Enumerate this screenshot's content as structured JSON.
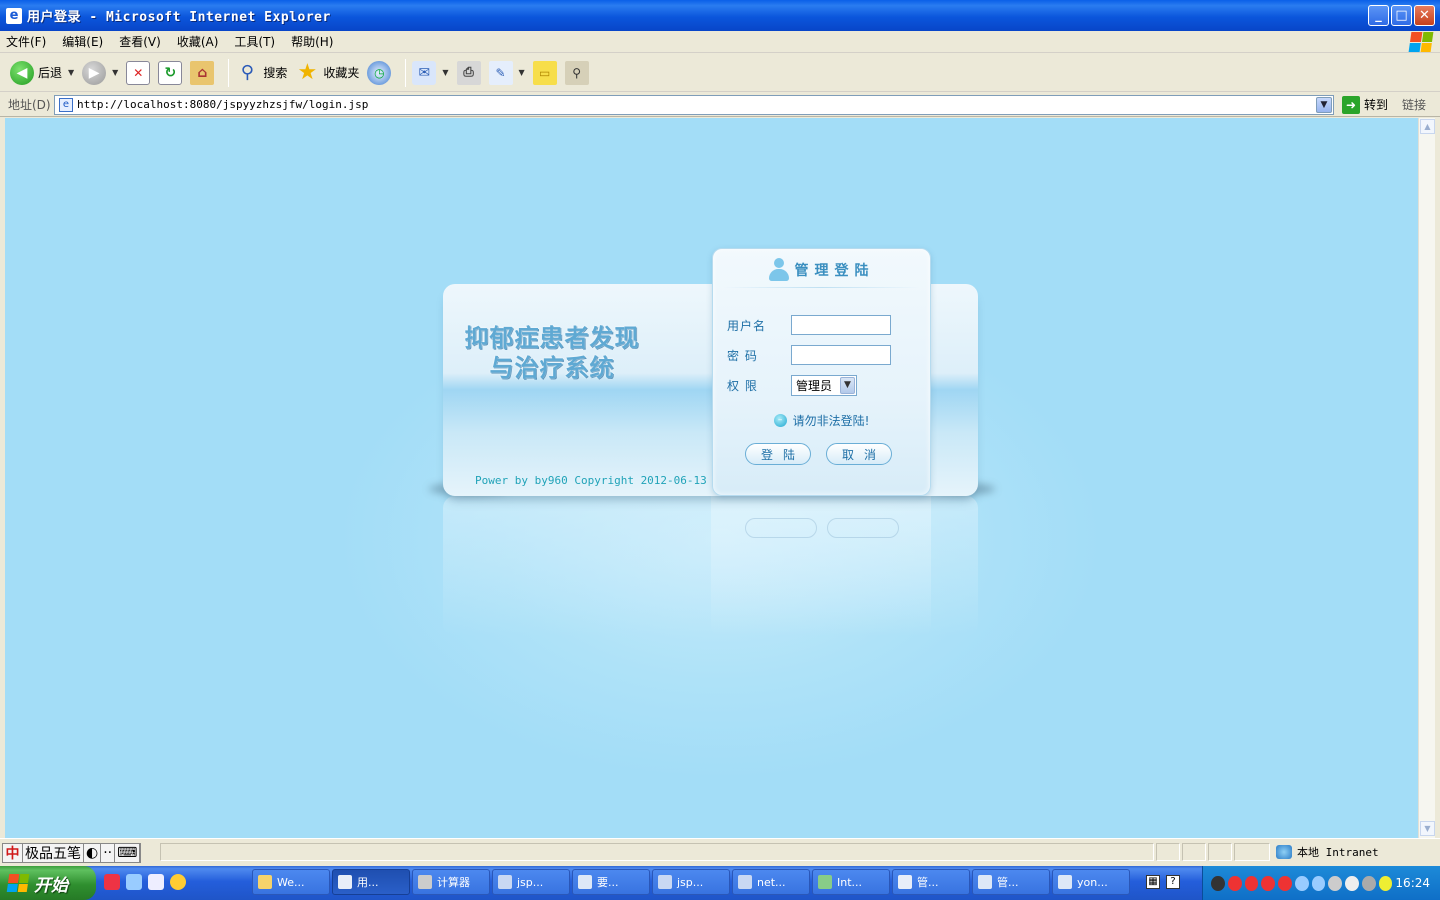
{
  "window": {
    "title": "用户登录 - Microsoft Internet Explorer",
    "minimize": "_",
    "maximize": "□",
    "close": "✕"
  },
  "menu": [
    "文件(F)",
    "编辑(E)",
    "查看(V)",
    "收藏(A)",
    "工具(T)",
    "帮助(H)"
  ],
  "toolbar": {
    "back_label": "后退",
    "search_label": "搜索",
    "favorites_label": "收藏夹"
  },
  "address": {
    "label": "地址(D)",
    "url": "http://localhost:8080/jspyyzhzsjfw/login.jsp",
    "go_label": "转到",
    "links_label": "链接"
  },
  "page": {
    "system_title_line1": "抑郁症患者发现",
    "system_title_line2": "与治疗系统",
    "powered_by": "Power by by960 Copyright 2012-06-13",
    "panel_title": "管理登陆",
    "username_label": "用户名",
    "password_label": "密  码",
    "role_label": "权  限",
    "role_selected": "管理员",
    "username_value": "",
    "password_value": "",
    "warning": "请勿非法登陆!",
    "login_button": "登陆",
    "cancel_button": "取消"
  },
  "statusbar": {
    "ime_name": "极品五笔",
    "zone": "本地 Intranet"
  },
  "taskbar": {
    "start_label": "开始",
    "tasks": [
      "We...",
      "用...",
      "计算器",
      "jsp...",
      "要...",
      "jsp...",
      "net...",
      "Int...",
      "管...",
      "管...",
      "yon..."
    ],
    "clock": "16:24"
  }
}
